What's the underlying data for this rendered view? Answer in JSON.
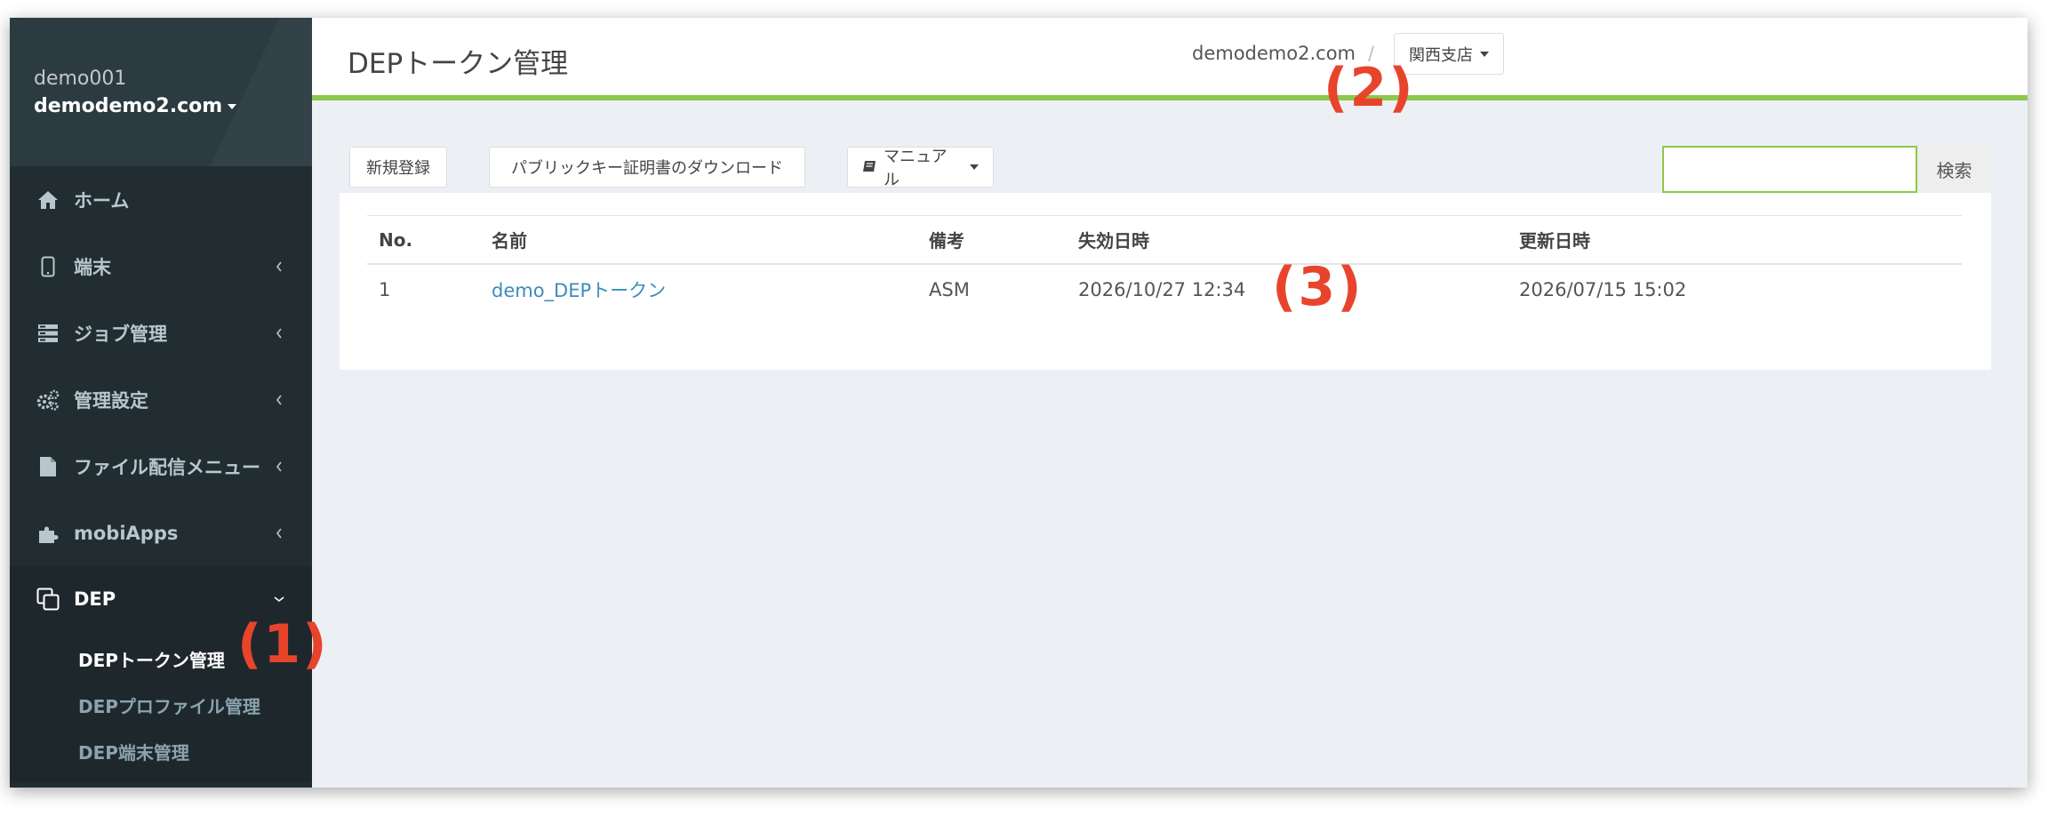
{
  "header": {
    "title": "DEPトークン管理",
    "domain": "demodemo2.com",
    "separator": "/",
    "branch": "関西支店"
  },
  "sidebar": {
    "user_id": "demo001",
    "user_domain": "demodemo2.com",
    "items": [
      {
        "label": "ホーム",
        "icon": "home-icon"
      },
      {
        "label": "端末",
        "icon": "mobile-icon"
      },
      {
        "label": "ジョブ管理",
        "icon": "server-icon"
      },
      {
        "label": "管理設定",
        "icon": "gears-icon"
      },
      {
        "label": "ファイル配信メニュー",
        "icon": "file-icon"
      },
      {
        "label": "mobiApps",
        "icon": "puzzle-icon"
      },
      {
        "label": "DEP",
        "icon": "copy-icon"
      }
    ],
    "dep_submenu": [
      "DEPトークン管理",
      "DEPプロファイル管理",
      "DEP端末管理"
    ]
  },
  "toolbar": {
    "new_label": "新規登録",
    "download_label": "パブリックキー証明書のダウンロード",
    "manual_label": "マニュアル",
    "search_label": "検索",
    "search_value": ""
  },
  "table": {
    "columns": [
      "No.",
      "名前",
      "備考",
      "失効日時",
      "更新日時"
    ],
    "rows": [
      [
        "1",
        "demo_DEPトークン",
        "ASM",
        "2026/10/27 12:34",
        "2026/07/15 15:02"
      ]
    ]
  },
  "annotations": {
    "a1": "(1)",
    "a2": "(2)",
    "a3": "(3)"
  },
  "colors": {
    "sidebar": "#222d32",
    "accent_green": "#8cc84b",
    "link": "#3c8dbc",
    "annotation": "#e8442c"
  }
}
